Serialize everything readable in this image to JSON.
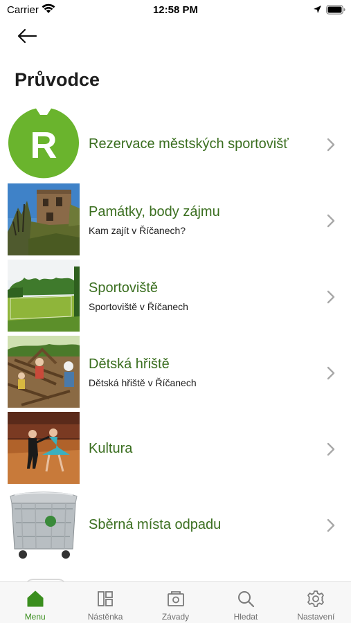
{
  "status_bar": {
    "carrier": "Carrier",
    "time": "12:58 PM"
  },
  "header": {
    "title": "Průvodce"
  },
  "list": [
    {
      "title": "Rezervace městských sportovišť",
      "subtitle": "",
      "icon": "letter-r-logo"
    },
    {
      "title": "Památky, body zájmu",
      "subtitle": "Kam zajít v Říčanech?",
      "icon": "castle-ruin-photo"
    },
    {
      "title": "Sportoviště",
      "subtitle": "Sportoviště v Říčanech",
      "icon": "sports-field-photo"
    },
    {
      "title": "Dětská hřiště",
      "subtitle": "Dětská hřiště v Říčanech",
      "icon": "playground-photo"
    },
    {
      "title": "Kultura",
      "subtitle": "",
      "icon": "dancers-photo"
    },
    {
      "title": "Sběrná místa odpadu",
      "subtitle": "",
      "icon": "waste-container-photo"
    }
  ],
  "logo_letter": "R",
  "tab_bar": {
    "tabs": [
      {
        "label": "Menu",
        "icon": "home-icon",
        "active": true
      },
      {
        "label": "Nástěnka",
        "icon": "board-icon",
        "active": false
      },
      {
        "label": "Závady",
        "icon": "camera-icon",
        "active": false
      },
      {
        "label": "Hledat",
        "icon": "search-icon",
        "active": false
      },
      {
        "label": "Nastavení",
        "icon": "gear-icon",
        "active": false
      }
    ]
  },
  "colors": {
    "accent_green": "#3a8e1e",
    "title_green": "#3a6e1f",
    "logo_green": "#6ab42d"
  }
}
